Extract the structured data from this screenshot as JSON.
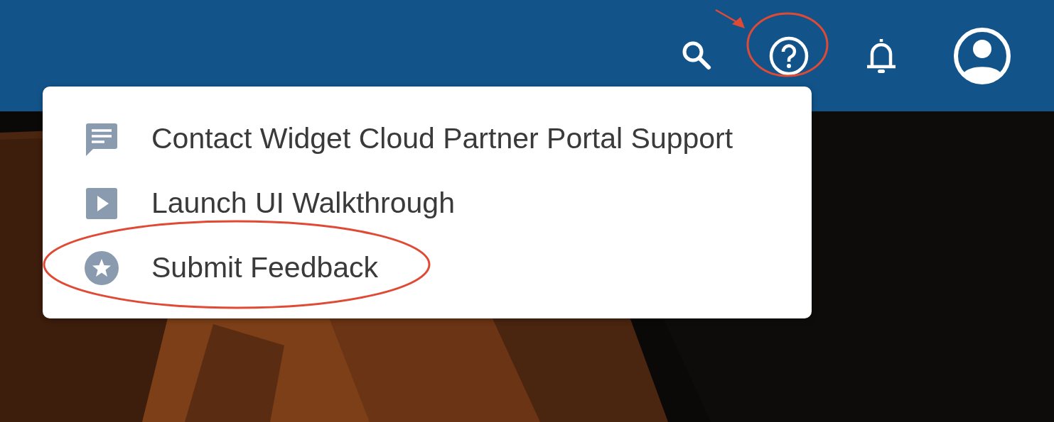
{
  "help_menu": {
    "items": [
      {
        "label": "Contact Widget Cloud Partner Portal Support",
        "kind": "chat"
      },
      {
        "label": "Launch UI Walkthrough",
        "kind": "play"
      },
      {
        "label": "Submit Feedback",
        "kind": "star"
      }
    ]
  }
}
